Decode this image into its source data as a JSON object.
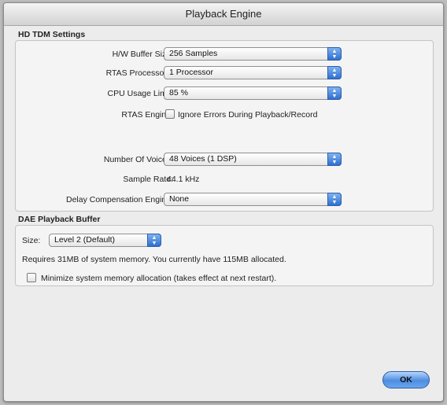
{
  "window": {
    "title": "Playback Engine"
  },
  "hd_tdm": {
    "section_label": "HD TDM Settings",
    "hw_buffer": {
      "label": "H/W Buffer Size:",
      "value": "256 Samples"
    },
    "rtas_processors": {
      "label": "RTAS Processors:",
      "value": "1 Processor"
    },
    "cpu_limit": {
      "label": "CPU Usage Limit:",
      "value": "85 %"
    },
    "rtas_engine": {
      "label": "RTAS Engine:",
      "checkbox_label": "Ignore Errors During Playback/Record",
      "checked": false
    },
    "voices": {
      "label": "Number Of Voices:",
      "value": "48 Voices (1 DSP)"
    },
    "sample_rate": {
      "label": "Sample Rate:",
      "value": "44.1 kHz"
    },
    "delay_comp": {
      "label": "Delay Compensation Engine:",
      "value": "None"
    }
  },
  "dae_buffer": {
    "section_label": "DAE Playback Buffer",
    "size": {
      "label": "Size:",
      "value": "Level 2 (Default)"
    },
    "memory_note": "Requires 31MB of system memory. You currently have 115MB allocated.",
    "minimize": {
      "label": "Minimize system memory allocation (takes effect at next restart).",
      "checked": false
    }
  },
  "buttons": {
    "ok": "OK"
  },
  "colors": {
    "accent": "#2f6fd0",
    "window_bg": "#ececec"
  }
}
